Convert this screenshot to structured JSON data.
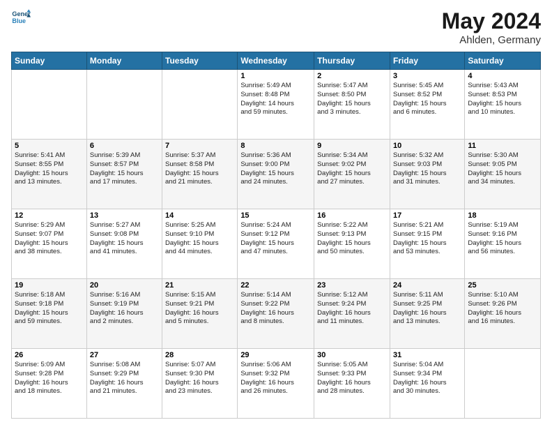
{
  "logo": {
    "line1": "General",
    "line2": "Blue"
  },
  "title": "May 2024",
  "subtitle": "Ahlden, Germany",
  "days_of_week": [
    "Sunday",
    "Monday",
    "Tuesday",
    "Wednesday",
    "Thursday",
    "Friday",
    "Saturday"
  ],
  "weeks": [
    [
      {
        "day": "",
        "info": ""
      },
      {
        "day": "",
        "info": ""
      },
      {
        "day": "",
        "info": ""
      },
      {
        "day": "1",
        "info": "Sunrise: 5:49 AM\nSunset: 8:48 PM\nDaylight: 14 hours\nand 59 minutes."
      },
      {
        "day": "2",
        "info": "Sunrise: 5:47 AM\nSunset: 8:50 PM\nDaylight: 15 hours\nand 3 minutes."
      },
      {
        "day": "3",
        "info": "Sunrise: 5:45 AM\nSunset: 8:52 PM\nDaylight: 15 hours\nand 6 minutes."
      },
      {
        "day": "4",
        "info": "Sunrise: 5:43 AM\nSunset: 8:53 PM\nDaylight: 15 hours\nand 10 minutes."
      }
    ],
    [
      {
        "day": "5",
        "info": "Sunrise: 5:41 AM\nSunset: 8:55 PM\nDaylight: 15 hours\nand 13 minutes."
      },
      {
        "day": "6",
        "info": "Sunrise: 5:39 AM\nSunset: 8:57 PM\nDaylight: 15 hours\nand 17 minutes."
      },
      {
        "day": "7",
        "info": "Sunrise: 5:37 AM\nSunset: 8:58 PM\nDaylight: 15 hours\nand 21 minutes."
      },
      {
        "day": "8",
        "info": "Sunrise: 5:36 AM\nSunset: 9:00 PM\nDaylight: 15 hours\nand 24 minutes."
      },
      {
        "day": "9",
        "info": "Sunrise: 5:34 AM\nSunset: 9:02 PM\nDaylight: 15 hours\nand 27 minutes."
      },
      {
        "day": "10",
        "info": "Sunrise: 5:32 AM\nSunset: 9:03 PM\nDaylight: 15 hours\nand 31 minutes."
      },
      {
        "day": "11",
        "info": "Sunrise: 5:30 AM\nSunset: 9:05 PM\nDaylight: 15 hours\nand 34 minutes."
      }
    ],
    [
      {
        "day": "12",
        "info": "Sunrise: 5:29 AM\nSunset: 9:07 PM\nDaylight: 15 hours\nand 38 minutes."
      },
      {
        "day": "13",
        "info": "Sunrise: 5:27 AM\nSunset: 9:08 PM\nDaylight: 15 hours\nand 41 minutes."
      },
      {
        "day": "14",
        "info": "Sunrise: 5:25 AM\nSunset: 9:10 PM\nDaylight: 15 hours\nand 44 minutes."
      },
      {
        "day": "15",
        "info": "Sunrise: 5:24 AM\nSunset: 9:12 PM\nDaylight: 15 hours\nand 47 minutes."
      },
      {
        "day": "16",
        "info": "Sunrise: 5:22 AM\nSunset: 9:13 PM\nDaylight: 15 hours\nand 50 minutes."
      },
      {
        "day": "17",
        "info": "Sunrise: 5:21 AM\nSunset: 9:15 PM\nDaylight: 15 hours\nand 53 minutes."
      },
      {
        "day": "18",
        "info": "Sunrise: 5:19 AM\nSunset: 9:16 PM\nDaylight: 15 hours\nand 56 minutes."
      }
    ],
    [
      {
        "day": "19",
        "info": "Sunrise: 5:18 AM\nSunset: 9:18 PM\nDaylight: 15 hours\nand 59 minutes."
      },
      {
        "day": "20",
        "info": "Sunrise: 5:16 AM\nSunset: 9:19 PM\nDaylight: 16 hours\nand 2 minutes."
      },
      {
        "day": "21",
        "info": "Sunrise: 5:15 AM\nSunset: 9:21 PM\nDaylight: 16 hours\nand 5 minutes."
      },
      {
        "day": "22",
        "info": "Sunrise: 5:14 AM\nSunset: 9:22 PM\nDaylight: 16 hours\nand 8 minutes."
      },
      {
        "day": "23",
        "info": "Sunrise: 5:12 AM\nSunset: 9:24 PM\nDaylight: 16 hours\nand 11 minutes."
      },
      {
        "day": "24",
        "info": "Sunrise: 5:11 AM\nSunset: 9:25 PM\nDaylight: 16 hours\nand 13 minutes."
      },
      {
        "day": "25",
        "info": "Sunrise: 5:10 AM\nSunset: 9:26 PM\nDaylight: 16 hours\nand 16 minutes."
      }
    ],
    [
      {
        "day": "26",
        "info": "Sunrise: 5:09 AM\nSunset: 9:28 PM\nDaylight: 16 hours\nand 18 minutes."
      },
      {
        "day": "27",
        "info": "Sunrise: 5:08 AM\nSunset: 9:29 PM\nDaylight: 16 hours\nand 21 minutes."
      },
      {
        "day": "28",
        "info": "Sunrise: 5:07 AM\nSunset: 9:30 PM\nDaylight: 16 hours\nand 23 minutes."
      },
      {
        "day": "29",
        "info": "Sunrise: 5:06 AM\nSunset: 9:32 PM\nDaylight: 16 hours\nand 26 minutes."
      },
      {
        "day": "30",
        "info": "Sunrise: 5:05 AM\nSunset: 9:33 PM\nDaylight: 16 hours\nand 28 minutes."
      },
      {
        "day": "31",
        "info": "Sunrise: 5:04 AM\nSunset: 9:34 PM\nDaylight: 16 hours\nand 30 minutes."
      },
      {
        "day": "",
        "info": ""
      }
    ]
  ]
}
